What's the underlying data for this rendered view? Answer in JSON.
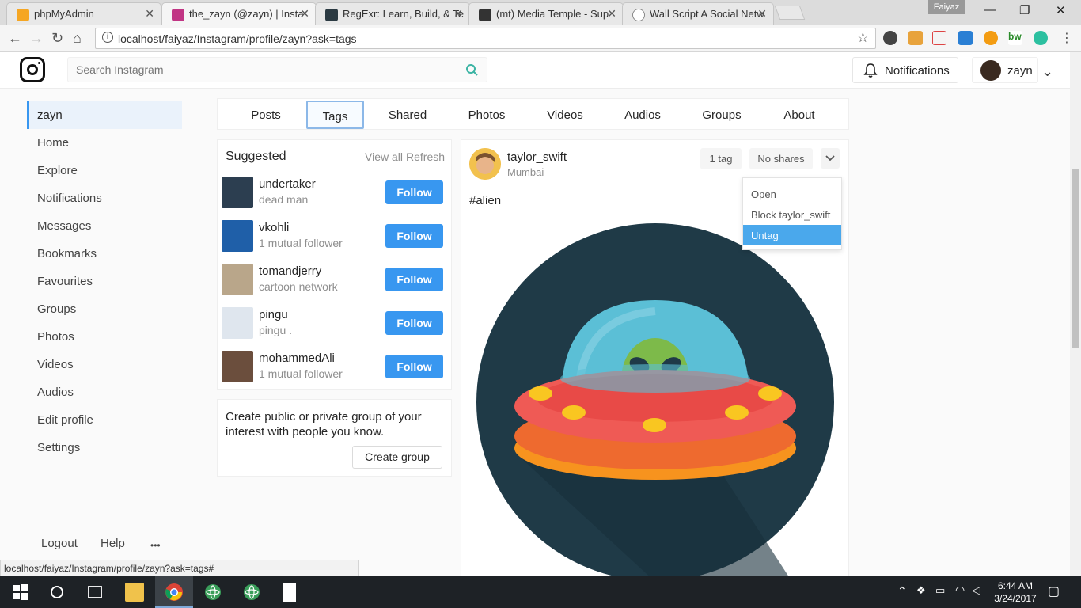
{
  "browser": {
    "tabs": [
      {
        "title": "phpMyAdmin",
        "favicon_color": "#f5a623"
      },
      {
        "title": "the_zayn (@zayn) | Insta",
        "favicon_color": "#c13584"
      },
      {
        "title": "RegExr: Learn, Build, & Te",
        "favicon_color": "#2b3a42"
      },
      {
        "title": "(mt) Media Temple - Sup",
        "favicon_color": "#333333"
      },
      {
        "title": "Wall Script A Social Netw",
        "favicon_color": "#888888"
      }
    ],
    "profile_name": "Faiyaz",
    "url": "localhost/faiyaz/Instagram/profile/zayn?ask=tags",
    "status_url": "localhost/faiyaz/Instagram/profile/zayn?ask=tags#"
  },
  "header": {
    "search_placeholder": "Search Instagram",
    "notifications_label": "Notifications",
    "username": "zayn",
    "accent_color": "#3897f0"
  },
  "sidebar": {
    "items": [
      "zayn",
      "Home",
      "Explore",
      "Notifications",
      "Messages",
      "Bookmarks",
      "Favourites",
      "Groups",
      "Photos",
      "Videos",
      "Audios",
      "Edit profile",
      "Settings"
    ],
    "footer": {
      "logout": "Logout",
      "help": "Help",
      "more": "•••"
    }
  },
  "profile_tabs": [
    "Posts",
    "Tags",
    "Shared",
    "Photos",
    "Videos",
    "Audios",
    "Groups",
    "About"
  ],
  "active_tab": "Tags",
  "suggested": {
    "title": "Suggested",
    "view_all": "View all",
    "refresh": "Refresh",
    "users": [
      {
        "name": "undertaker",
        "sub": "dead man",
        "follow": "Follow",
        "avatar_color": "#2c3e50"
      },
      {
        "name": "vkohli",
        "sub": "1 mutual follower",
        "follow": "Follow",
        "avatar_color": "#1f5fa8"
      },
      {
        "name": "tomandjerry",
        "sub": "cartoon network",
        "follow": "Follow",
        "avatar_color": "#b9a68a"
      },
      {
        "name": "pingu",
        "sub": "pingu .",
        "follow": "Follow",
        "avatar_color": "#dfe6ee"
      },
      {
        "name": "mohammedAli",
        "sub": "1 mutual follower",
        "follow": "Follow",
        "avatar_color": "#6b4e3d"
      }
    ]
  },
  "group_card": {
    "text": "Create public or private group of your interest with people you know.",
    "button": "Create group"
  },
  "post": {
    "author": "taylor_swift",
    "location": "Mumbai",
    "tag_count": "1 tag",
    "shares": "No shares",
    "caption": "#alien",
    "menu": [
      "Open",
      "Block taylor_swift",
      "Untag"
    ],
    "menu_active": "Untag"
  },
  "taskbar": {
    "time": "6:44 AM",
    "date": "3/24/2017"
  }
}
